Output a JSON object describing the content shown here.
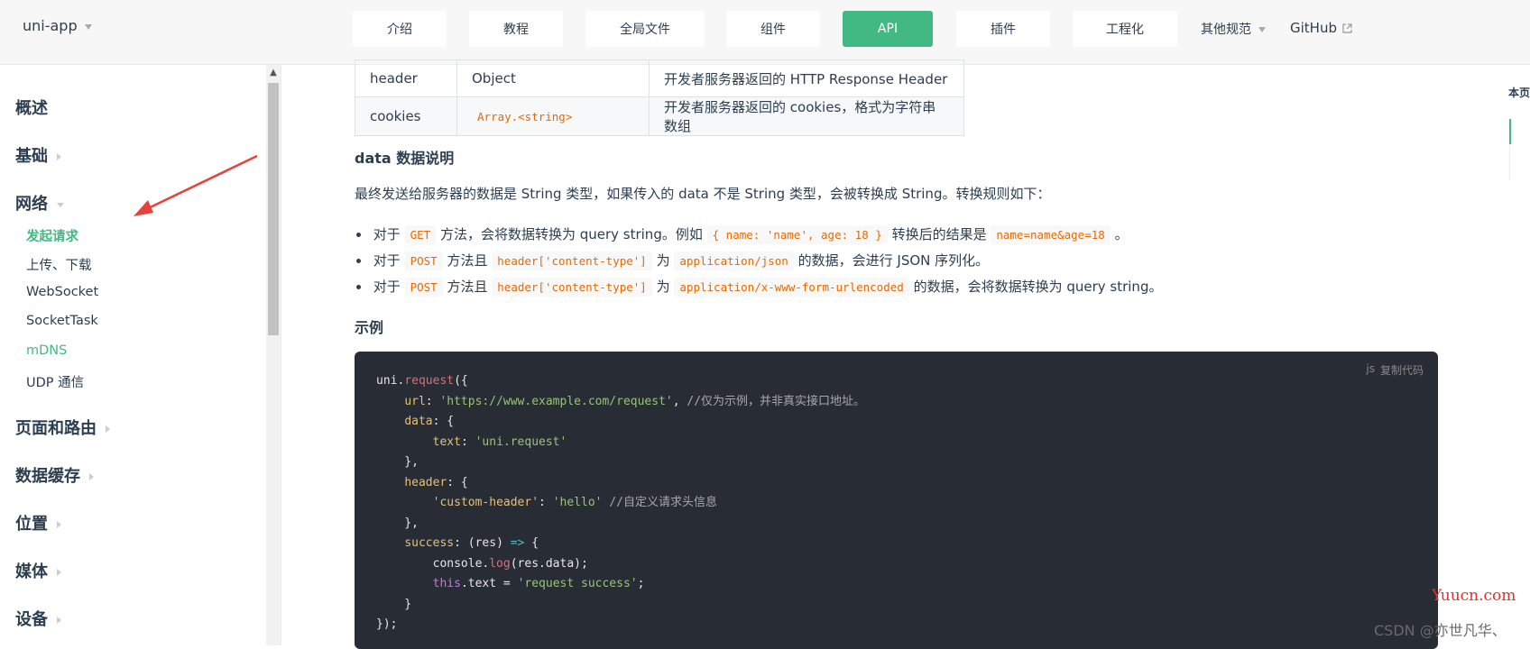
{
  "brand": "uni-app",
  "nav": {
    "buttons": [
      "介绍",
      "教程",
      "全局文件",
      "组件",
      "API",
      "插件",
      "工程化"
    ],
    "active": "API",
    "other": "其他规范",
    "github": "GitHub"
  },
  "sidebar": {
    "groups": [
      "概述",
      "基础",
      "网络",
      "页面和路由",
      "数据缓存",
      "位置",
      "媒体",
      "设备"
    ],
    "network_items": [
      "发起请求",
      "上传、下载",
      "WebSocket",
      "SocketTask",
      "mDNS",
      "UDP 通信"
    ],
    "active_item": "发起请求"
  },
  "table": {
    "rows": [
      {
        "name": "header",
        "type": "Object",
        "desc": "开发者服务器返回的 HTTP Response Header"
      },
      {
        "name": "cookies",
        "type": "Array.<string>",
        "desc": "开发者服务器返回的 cookies，格式为字符串数组"
      }
    ]
  },
  "data_section": {
    "title": "data 数据说明",
    "intro": "最终发送给服务器的数据是 String 类型，如果传入的 data 不是 String 类型，会被转换成 String。转换规则如下：",
    "b1": {
      "t1": "对于",
      "c1": "GET",
      "t2": "方法，会将数据转换为 query string。例如",
      "c2": "{ name: 'name', age: 18 }",
      "t3": "转换后的结果是",
      "c3": "name=name&age=18",
      "t4": "。"
    },
    "b2": {
      "t1": "对于",
      "c1": "POST",
      "t2": "方法且",
      "c2": "header['content-type']",
      "t3": "为",
      "c3": "application/json",
      "t4": "的数据，会进行 JSON 序列化。"
    },
    "b3": {
      "t1": "对于",
      "c1": "POST",
      "t2": "方法且",
      "c2": "header['content-type']",
      "t3": "为",
      "c3": "application/x-www-form-urlencoded",
      "t4": "的数据，会将数据转换为 query string。"
    }
  },
  "example": {
    "title": "示例",
    "lang": "js",
    "copy": "复制代码",
    "url": "'https://www.example.com/request'",
    "url_comment": "//仅为示例，并非真实接口地址。",
    "text_value": "'uni.request'",
    "header_key": "'custom-header'",
    "header_value": "'hello'",
    "header_comment": "//自定义请求头信息",
    "success_text": "'request success'"
  },
  "toc": {
    "title": "本页"
  },
  "watermark": {
    "site": "Yuucn.com",
    "csdn": "CSDN @亦世凡华、"
  }
}
